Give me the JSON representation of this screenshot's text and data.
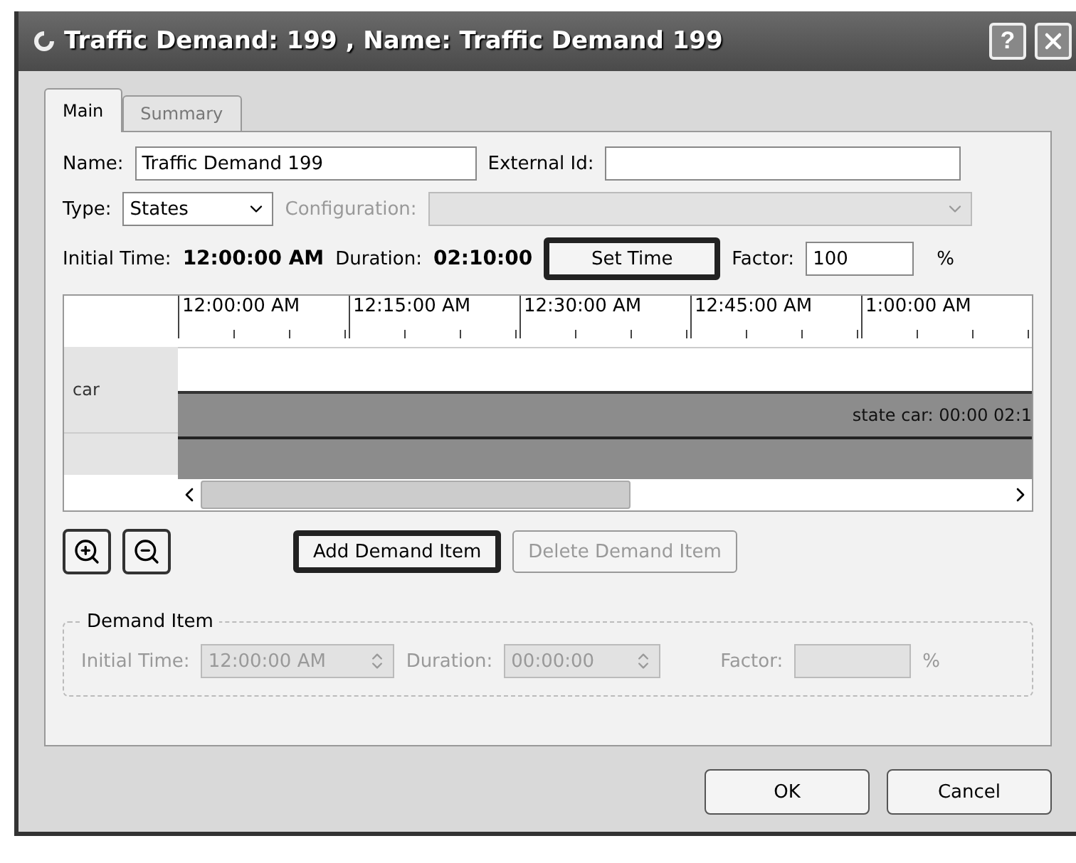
{
  "window": {
    "title": "Traffic Demand: 199 , Name: Traffic Demand 199",
    "help": "?"
  },
  "tabs": [
    {
      "label": "Main",
      "selected": true
    },
    {
      "label": "Summary",
      "selected": false
    }
  ],
  "name_row": {
    "name_label": "Name:",
    "name_value": "Traffic Demand 199",
    "external_label": "External Id:"
  },
  "type_row": {
    "type_label": "Type:",
    "type_value": "States",
    "config_label": "Configuration:",
    "config_disabled": true
  },
  "time_row": {
    "initial_label": "Initial Time:",
    "initial_value": "12:00:00 AM",
    "duration_label": "Duration:",
    "duration_value": "02:10:00",
    "set_time": {
      "label": "Set Time",
      "highlighted": true
    },
    "factor_label": "Factor:",
    "factor_value": "100",
    "percent": "%"
  },
  "timeline": {
    "ticks": [
      "12:00:00 AM",
      "12:15:00 AM",
      "12:30:00 AM",
      "12:45:00 AM",
      "1:00:00 AM"
    ],
    "rows": [
      {
        "label": "car",
        "bar": "state car: 00:00 02:1"
      }
    ]
  },
  "actions": [
    {
      "label": "Add Demand Item",
      "highlighted": true,
      "disabled": false
    },
    {
      "label": "Delete Demand Item",
      "highlighted": false,
      "disabled": true
    }
  ],
  "demand_item": {
    "title": "Demand Item",
    "disabled": true,
    "initial_label": "Initial Time:",
    "initial_value": "12:00:00 AM",
    "duration_label": "Duration:",
    "duration_value": "00:00:00",
    "factor_label": "Factor:",
    "percent": "%"
  },
  "buttons": [
    "OK",
    "Cancel"
  ]
}
